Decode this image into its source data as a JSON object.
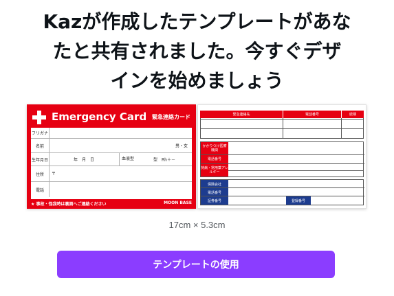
{
  "headline": {
    "line1": "Kazが作成したテンプレートがあな",
    "line2": "たと共有されました。今すぐデザ",
    "line3": "インを始めましょう"
  },
  "preview": {
    "front": {
      "title": "Emergency Card",
      "subtitle": "緊急連絡カード",
      "rows": [
        {
          "label": "フリガナ",
          "value": ""
        },
        {
          "label": "名前",
          "value": "男・女"
        },
        {
          "label": "生年月日",
          "value": "年　月　日"
        },
        {
          "label": "住所",
          "value": "〒"
        },
        {
          "label": "電話",
          "value": ""
        }
      ],
      "blood_label": "血液型",
      "blood_value": "型　Rh＋－",
      "footer_note": "★ 事故・怪我時は裏面へご連絡ください",
      "brand": "MOON BASE"
    },
    "back": {
      "contact_headers": [
        "緊急連絡先",
        "電話番号",
        "続柄"
      ],
      "medical_labels": [
        "かかりつけ医療機関",
        "電話番号",
        "持病・常用薬アレルギー"
      ],
      "insurance_labels": [
        "保険会社",
        "電話番号",
        "証券番号"
      ],
      "registration_label": "登録番号"
    }
  },
  "dimensions": "17cm × 5.3cm",
  "use_button_label": "テンプレートの使用",
  "colors": {
    "accent": "#8b3dff",
    "card_red": "#e60012",
    "card_blue": "#1d3c8f"
  }
}
